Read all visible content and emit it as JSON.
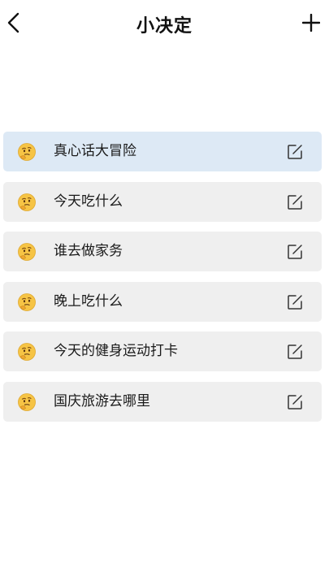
{
  "header": {
    "title": "小决定",
    "back_icon": "chevron-left-icon",
    "add_icon": "plus-icon"
  },
  "list": {
    "items": [
      {
        "label": "真心话大冒险",
        "active": true
      },
      {
        "label": "今天吃什么",
        "active": false
      },
      {
        "label": "谁去做家务",
        "active": false
      },
      {
        "label": "晚上吃什么",
        "active": false
      },
      {
        "label": "今天的健身运动打卡",
        "active": false
      },
      {
        "label": "国庆旅游去哪里",
        "active": false
      }
    ],
    "item_icon": "thinking-face-icon",
    "edit_icon": "edit-icon"
  },
  "colors": {
    "background": "#ffffff",
    "item_bg": "#efefef",
    "item_active_bg": "#dde9f5",
    "text": "#1a1a1a"
  }
}
